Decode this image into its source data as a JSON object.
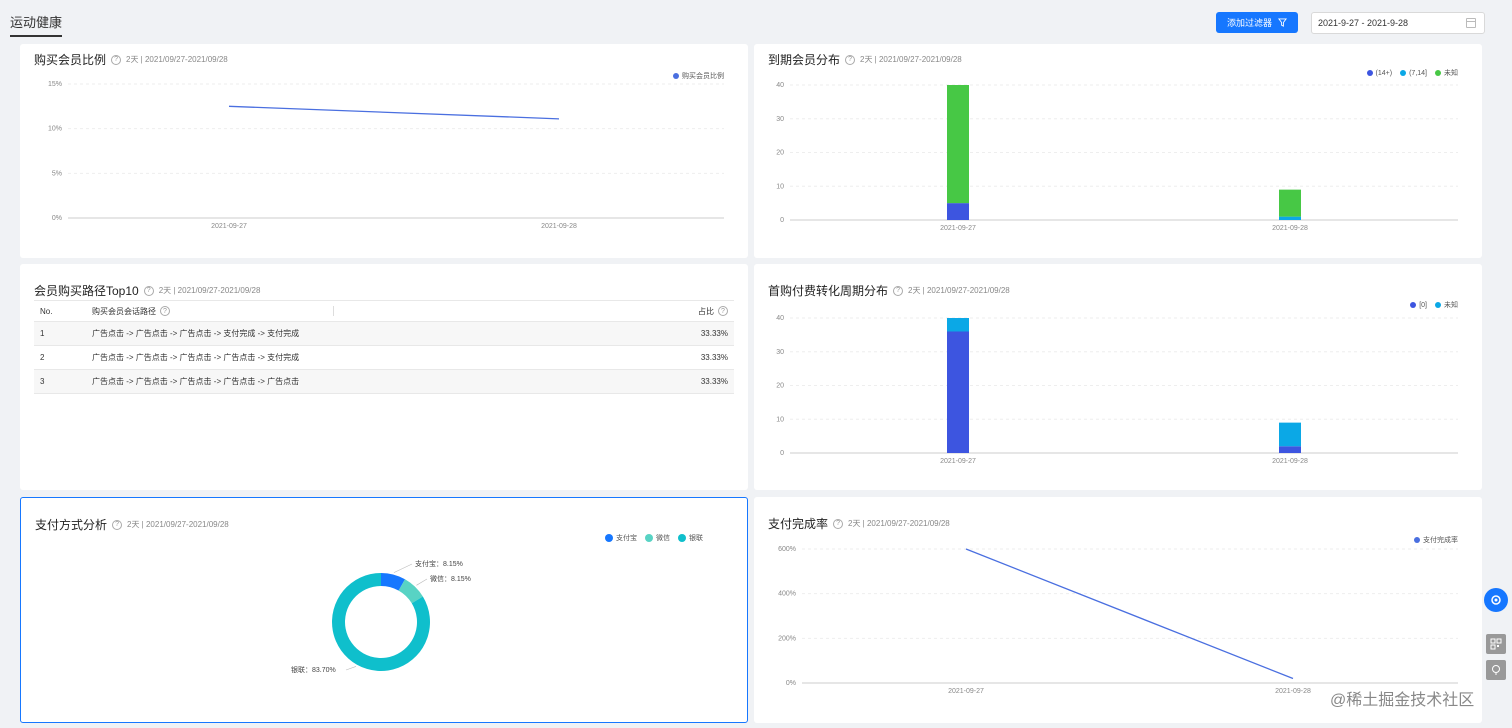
{
  "page_title": "运动健康",
  "toolbar": {
    "filter_label": "添加过滤器",
    "date_range": "2021-9-27 - 2021-9-28"
  },
  "cards": {
    "member_ratio": {
      "title": "购买会员比例",
      "sub": "2天 | 2021/09/27-2021/09/28"
    },
    "expiry": {
      "title": "到期会员分布",
      "sub": "2天 | 2021/09/27-2021/09/28"
    },
    "path_top10": {
      "title": "会员购买路径Top10",
      "sub": "2天 | 2021/09/27-2021/09/28"
    },
    "first_cycle": {
      "title": "首购付费转化周期分布",
      "sub": "2天 | 2021/09/27-2021/09/28"
    },
    "payment": {
      "title": "支付方式分析",
      "sub": "2天 | 2021/09/27-2021/09/28"
    },
    "pay_rate": {
      "title": "支付完成率",
      "sub": "2天 | 2021/09/27-2021/09/28"
    }
  },
  "table": {
    "headers": {
      "no": "No.",
      "path": "购买会员会话路径",
      "pct": "占比"
    },
    "rows": [
      {
        "no": "1",
        "path": "广告点击 -> 广告点击 -> 广告点击 -> 支付完成 -> 支付完成",
        "pct": "33.33%"
      },
      {
        "no": "2",
        "path": "广告点击 -> 广告点击 -> 广告点击 -> 广告点击 -> 支付完成",
        "pct": "33.33%"
      },
      {
        "no": "3",
        "path": "广告点击 -> 广告点击 -> 广告点击 -> 广告点击 -> 广告点击",
        "pct": "33.33%"
      }
    ]
  },
  "colors": {
    "blue": "#3d55e0",
    "green": "#47c845",
    "cyan": "#0ba8e6",
    "teal": "#0fbfcc",
    "light_teal": "#58d3c4",
    "line": "#4a6fe0",
    "accent": "#1677ff"
  },
  "watermark": "@稀土掘金技术社区",
  "chart_data": [
    {
      "type": "line",
      "title": "购买会员比例",
      "x": [
        "2021-09-27",
        "2021-09-28"
      ],
      "series": [
        {
          "name": "购买会员比例",
          "values": [
            12.5,
            11.1
          ]
        }
      ],
      "yticks": [
        "0%",
        "5%",
        "10%",
        "15%"
      ],
      "ylim": [
        0,
        15
      ]
    },
    {
      "type": "bar",
      "title": "到期会员分布",
      "categories": [
        "2021-09-27",
        "2021-09-28"
      ],
      "series": [
        {
          "name": "(14+)",
          "values": [
            5,
            0
          ]
        },
        {
          "name": "(7,14]",
          "values": [
            0,
            1
          ]
        },
        {
          "name": "未知",
          "values": [
            35,
            8
          ]
        }
      ],
      "yticks": [
        "0",
        "10",
        "20",
        "30",
        "40"
      ],
      "ylim": [
        0,
        40
      ]
    },
    {
      "type": "bar",
      "title": "首购付费转化周期分布",
      "categories": [
        "2021-09-27",
        "2021-09-28"
      ],
      "series": [
        {
          "name": "[0]",
          "values": [
            36,
            2
          ]
        },
        {
          "name": "未知",
          "values": [
            4,
            7
          ]
        }
      ],
      "yticks": [
        "0",
        "10",
        "20",
        "30",
        "40"
      ],
      "ylim": [
        0,
        40
      ]
    },
    {
      "type": "pie",
      "title": "支付方式分析",
      "series": [
        {
          "name": "支付宝",
          "value": 8.15,
          "label": "支付宝：8.15%"
        },
        {
          "name": "微信",
          "value": 8.15,
          "label": "微信：8.15%"
        },
        {
          "name": "银联",
          "value": 83.7,
          "label": "银联：83.70%"
        }
      ]
    },
    {
      "type": "line",
      "title": "支付完成率",
      "x": [
        "2021-09-27",
        "2021-09-28"
      ],
      "series": [
        {
          "name": "支付完成率",
          "values": [
            600,
            20
          ]
        }
      ],
      "yticks": [
        "0%",
        "200%",
        "400%",
        "600%"
      ],
      "ylim": [
        0,
        600
      ]
    }
  ]
}
